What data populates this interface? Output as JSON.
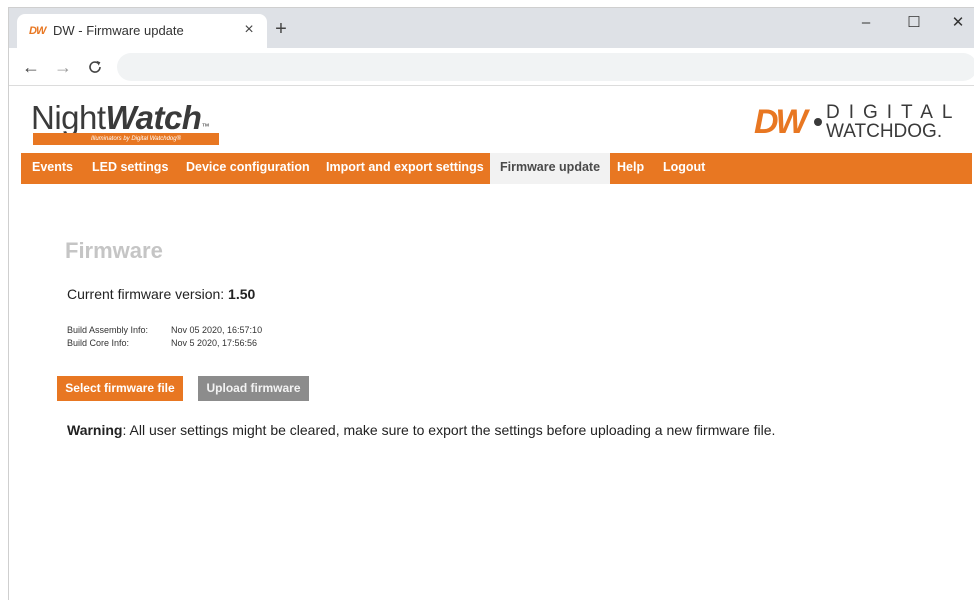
{
  "browser": {
    "tab": {
      "favicon": "DW",
      "title": "DW - Firmware update",
      "close_glyph": "×"
    },
    "newtab_glyph": "+",
    "window_controls": {
      "minimize": "–",
      "maximize": "☐",
      "close": "✕"
    },
    "nav": {
      "back": "←",
      "forward": "→",
      "reload": "C"
    }
  },
  "header": {
    "logo_left": {
      "prefix": "Night",
      "bold": "Watch",
      "tm": "™",
      "tagline": "Illuminators by Digital Watchdog®"
    },
    "logo_right": {
      "mark": "DW",
      "line1": "DIGITAL",
      "line2": "WATCHDOG."
    }
  },
  "nav": {
    "items": [
      {
        "label": "Events"
      },
      {
        "label": "LED settings"
      },
      {
        "label": "Device configuration"
      },
      {
        "label": "Import and export settings"
      },
      {
        "label": "Firmware update",
        "active": true
      },
      {
        "label": "Help"
      },
      {
        "label": "Logout"
      }
    ]
  },
  "content": {
    "heading": "Firmware",
    "version_label": "Current firmware version: ",
    "version_value": "1.50",
    "build_assembly_label": "Build Assembly Info:",
    "build_assembly_value": "Nov 05 2020, 16:57:10",
    "build_core_label": "Build Core Info:",
    "build_core_value": "Nov 5 2020, 17:56:56",
    "select_button": "Select firmware file",
    "upload_button": "Upload firmware",
    "warning_label": "Warning",
    "warning_text": ": All user settings might be cleared, make sure to export the settings before uploading a new firmware file."
  },
  "colors": {
    "accent": "#e87722",
    "upload_button": "#8c8c8c",
    "heading": "#c5c5c5",
    "tab_strip": "#dee1e6"
  }
}
